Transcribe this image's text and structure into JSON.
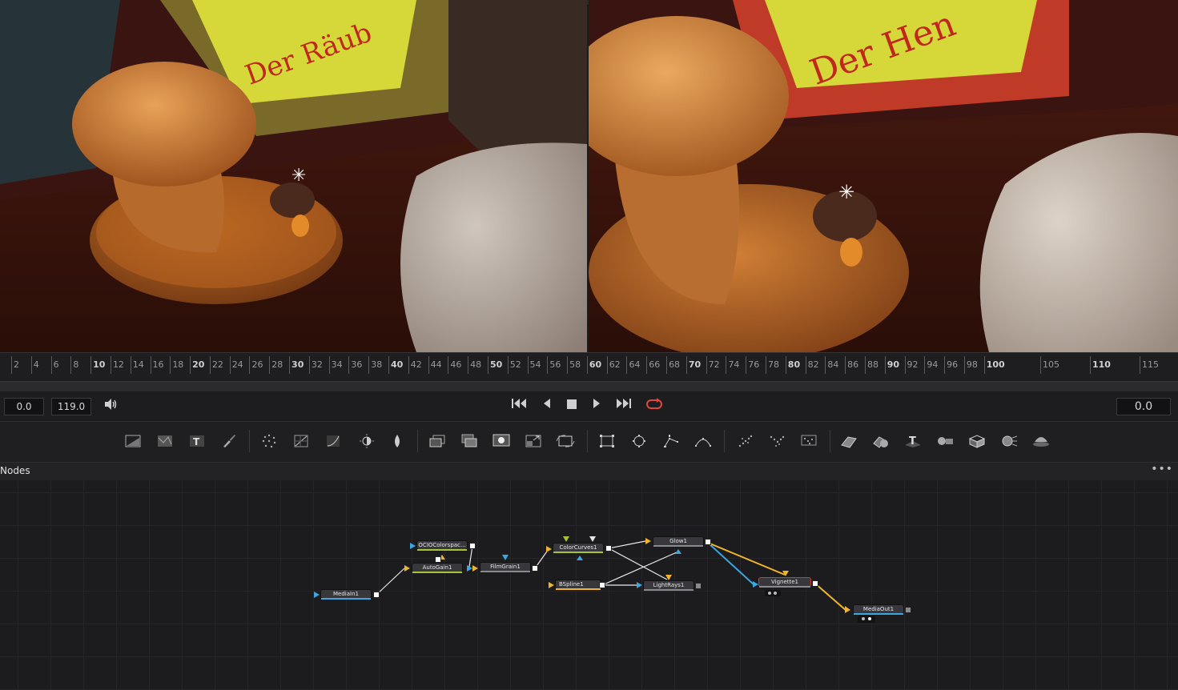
{
  "timeline": {
    "ticks": [
      "2",
      "4",
      "6",
      "8",
      "10",
      "12",
      "14",
      "16",
      "18",
      "20",
      "22",
      "24",
      "26",
      "28",
      "30",
      "32",
      "34",
      "36",
      "38",
      "40",
      "42",
      "44",
      "46",
      "48",
      "50",
      "52",
      "54",
      "56",
      "58",
      "60",
      "62",
      "64",
      "66",
      "68",
      "70",
      "72",
      "74",
      "76",
      "78",
      "80",
      "82",
      "84",
      "86",
      "88",
      "90",
      "92",
      "94",
      "96",
      "98",
      "100",
      "105",
      "110",
      "115"
    ]
  },
  "transport": {
    "start_frame": "0.0",
    "end_frame": "119.0",
    "current_frame": "0.0",
    "icons": [
      "speaker-icon",
      "go-to-start-icon",
      "play-reverse-icon",
      "stop-icon",
      "play-icon",
      "go-to-end-icon",
      "loop-icon"
    ]
  },
  "toolbar": {
    "icons": [
      "background-icon",
      "fast-noise-icon",
      "text-icon",
      "paint-icon",
      "particles-icon",
      "color-corrector-icon",
      "color-curves-icon",
      "brightness-contrast-icon",
      "blur-icon",
      "merge-icon",
      "channel-booleans-icon",
      "matte-control-icon",
      "resize-icon",
      "transform-icon",
      "rectangle-mask-icon",
      "ellipse-mask-icon",
      "polygon-mask-icon",
      "bspline-mask-icon",
      "p-emitter-icon",
      "p-render-icon",
      "p-kill-icon",
      "shape-3d-icon",
      "merge-3d-icon",
      "text-3d-icon",
      "camera-3d-icon",
      "image-plane-3d-icon",
      "renderer-3d-icon",
      "spotlight-3d-icon"
    ]
  },
  "nodes_panel": {
    "title": "Nodes",
    "menu": "•••"
  },
  "nodes": [
    {
      "id": "mediain",
      "label": "MediaIn1"
    },
    {
      "id": "ocio",
      "label": "OCIOColorspac..."
    },
    {
      "id": "autogain",
      "label": "AutoGain1"
    },
    {
      "id": "filmgrain",
      "label": "FilmGrain1"
    },
    {
      "id": "colorcurves",
      "label": "ColorCurves1"
    },
    {
      "id": "bspline",
      "label": "BSpline1"
    },
    {
      "id": "glow",
      "label": "Glow1"
    },
    {
      "id": "lightrays",
      "label": "LightRays1"
    },
    {
      "id": "vignette",
      "label": "Vignette1"
    },
    {
      "id": "mediaout",
      "label": "MediaOut1"
    }
  ],
  "colors": {
    "accent_loop": "#e0483c",
    "link_yellow": "#f0b52a",
    "link_blue": "#3aa7e0",
    "link_white": "#e8e8ea",
    "node_selected_outline": "#d23a30",
    "node_tool_green": "#a6c43a"
  }
}
